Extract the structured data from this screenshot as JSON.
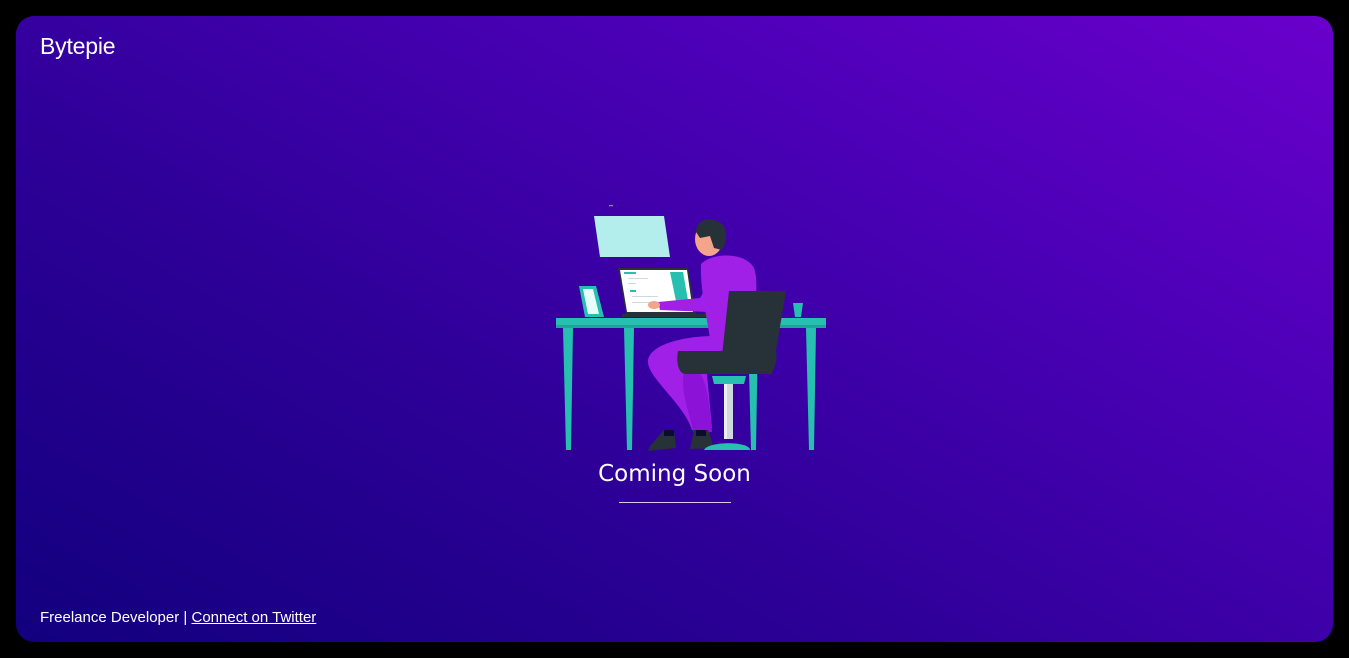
{
  "brand": {
    "name": "Bytepie"
  },
  "hero": {
    "illustration": "developer-at-desk-illustration",
    "heading": "Coming Soon"
  },
  "footer": {
    "tagline": "Freelance Developer",
    "separator": "|",
    "twitter_link": "Connect on Twitter"
  },
  "colors": {
    "gradient_start": "#12007e",
    "gradient_end": "#6a00cc",
    "accent_teal": "#26bfb0",
    "accent_purple": "#a020e8",
    "dark": "#263238"
  }
}
